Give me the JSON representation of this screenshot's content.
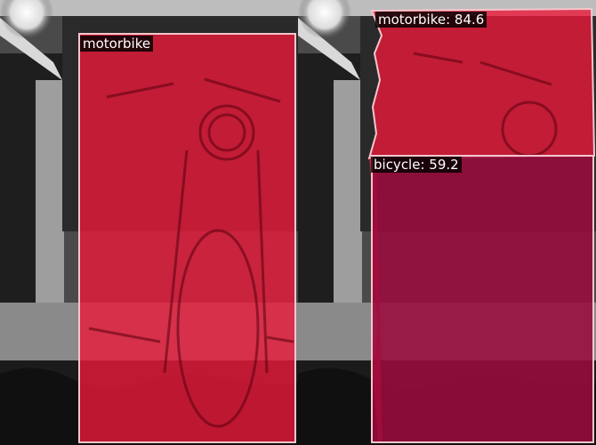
{
  "left_panel": {
    "detections": [
      {
        "label": "motorbike",
        "color": "#e8193a"
      }
    ]
  },
  "right_panel": {
    "detections": [
      {
        "label": "motorbike: 84.6",
        "color": "#e8193a"
      },
      {
        "label": "bicycle: 59.2",
        "color": "#9a0a3c"
      }
    ]
  }
}
